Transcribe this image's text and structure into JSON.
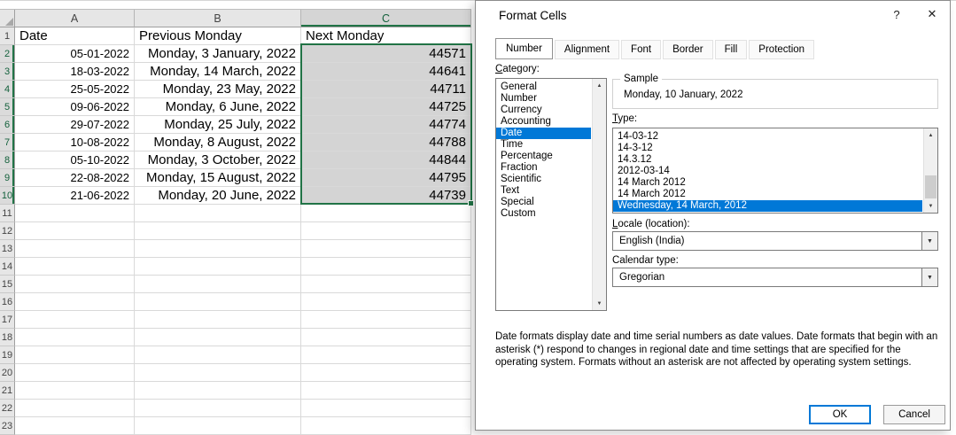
{
  "spreadsheet": {
    "columns": [
      "A",
      "B",
      "C"
    ],
    "selected_column": "C",
    "selected_range_rows": [
      2,
      10
    ],
    "rows": [
      {
        "n": 1,
        "a": "Date",
        "b": "Previous Monday",
        "c": "Next Monday"
      },
      {
        "n": 2,
        "a": "05-01-2022",
        "b": "Monday, 3 January, 2022",
        "c": "44571"
      },
      {
        "n": 3,
        "a": "18-03-2022",
        "b": "Monday, 14 March, 2022",
        "c": "44641"
      },
      {
        "n": 4,
        "a": "25-05-2022",
        "b": "Monday, 23 May, 2022",
        "c": "44711"
      },
      {
        "n": 5,
        "a": "09-06-2022",
        "b": "Monday, 6 June, 2022",
        "c": "44725"
      },
      {
        "n": 6,
        "a": "29-07-2022",
        "b": "Monday, 25 July, 2022",
        "c": "44774"
      },
      {
        "n": 7,
        "a": "10-08-2022",
        "b": "Monday, 8 August, 2022",
        "c": "44788"
      },
      {
        "n": 8,
        "a": "05-10-2022",
        "b": "Monday, 3 October, 2022",
        "c": "44844"
      },
      {
        "n": 9,
        "a": "22-08-2022",
        "b": "Monday, 15 August, 2022",
        "c": "44795"
      },
      {
        "n": 10,
        "a": "21-06-2022",
        "b": "Monday, 20 June, 2022",
        "c": "44739"
      },
      {
        "n": 11,
        "a": "",
        "b": "",
        "c": ""
      },
      {
        "n": 12,
        "a": "",
        "b": "",
        "c": ""
      },
      {
        "n": 13,
        "a": "",
        "b": "",
        "c": ""
      },
      {
        "n": 14,
        "a": "",
        "b": "",
        "c": ""
      },
      {
        "n": 15,
        "a": "",
        "b": "",
        "c": ""
      },
      {
        "n": 16,
        "a": "",
        "b": "",
        "c": ""
      },
      {
        "n": 17,
        "a": "",
        "b": "",
        "c": ""
      },
      {
        "n": 18,
        "a": "",
        "b": "",
        "c": ""
      },
      {
        "n": 19,
        "a": "",
        "b": "",
        "c": ""
      },
      {
        "n": 20,
        "a": "",
        "b": "",
        "c": ""
      },
      {
        "n": 21,
        "a": "",
        "b": "",
        "c": ""
      },
      {
        "n": 22,
        "a": "",
        "b": "",
        "c": ""
      },
      {
        "n": 23,
        "a": "",
        "b": "",
        "c": ""
      }
    ]
  },
  "dialog": {
    "title": "Format Cells",
    "tabs": [
      "Number",
      "Alignment",
      "Font",
      "Border",
      "Fill",
      "Protection"
    ],
    "active_tab": "Number",
    "category_label": "Category:",
    "categories": [
      "General",
      "Number",
      "Currency",
      "Accounting",
      "Date",
      "Time",
      "Percentage",
      "Fraction",
      "Scientific",
      "Text",
      "Special",
      "Custom"
    ],
    "selected_category": "Date",
    "sample_label": "Sample",
    "sample_value": "Monday, 10 January, 2022",
    "type_label": "Type:",
    "types": [
      "14-03-12",
      "14-3-12",
      "14.3.12",
      "2012-03-14",
      "14 March 2012",
      "14 March 2012",
      "Wednesday, 14 March, 2012"
    ],
    "selected_type_index": 6,
    "locale_label": "Locale (location):",
    "locale_value": "English (India)",
    "calendar_label": "Calendar type:",
    "calendar_value": "Gregorian",
    "description": "Date formats display date and time serial numbers as date values.  Date formats that begin with an asterisk (*) respond to changes in regional date and time settings that are specified for the operating system. Formats without an asterisk are not affected by operating system settings.",
    "ok_label": "OK",
    "cancel_label": "Cancel",
    "icons": {
      "help": "?",
      "close": "✕",
      "arrow_up": "▲",
      "arrow_down": "▼",
      "dropdown": "▼"
    },
    "colors": {
      "accent_green": "#217346",
      "selection_blue": "#0078d7"
    }
  }
}
